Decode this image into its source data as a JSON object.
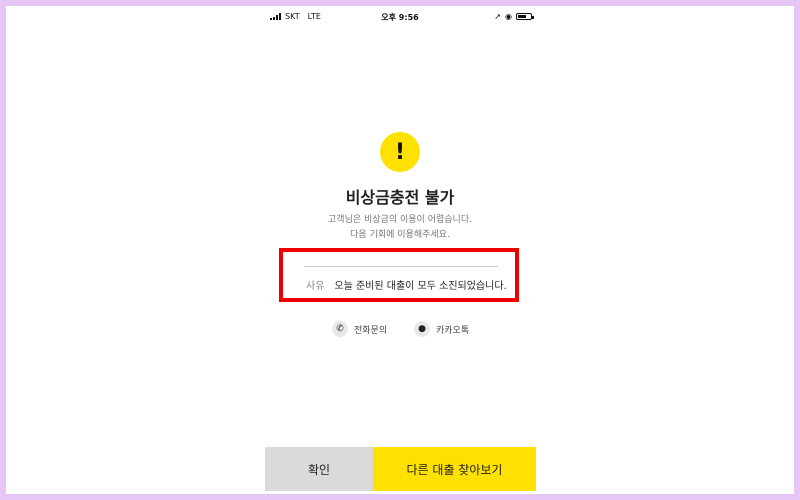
{
  "status_bar": {
    "carrier": "SKT",
    "network": "LTE",
    "time": "오후 9:56",
    "battery_level": 0.6,
    "icons": [
      "signal-icon",
      "location-arrow-icon",
      "alarm-icon",
      "battery-icon"
    ]
  },
  "alert": {
    "icon_symbol": "!",
    "icon_color": "#ffe100",
    "title": "비상금충전 불가",
    "desc_line1": "고객님은 비상금의 이용이 어렵습니다.",
    "desc_line2": "다음 기회에 이용해주세요."
  },
  "reason": {
    "label": "사유",
    "text": "오늘 준비된 대출이 모두 소진되었습니다."
  },
  "highlight_color": "#ee0000",
  "contacts": {
    "phone_label": "전화문의",
    "kakao_label": "카카오톡"
  },
  "buttons": {
    "confirm": "확인",
    "find_other": "다른 대출 찾아보기"
  }
}
